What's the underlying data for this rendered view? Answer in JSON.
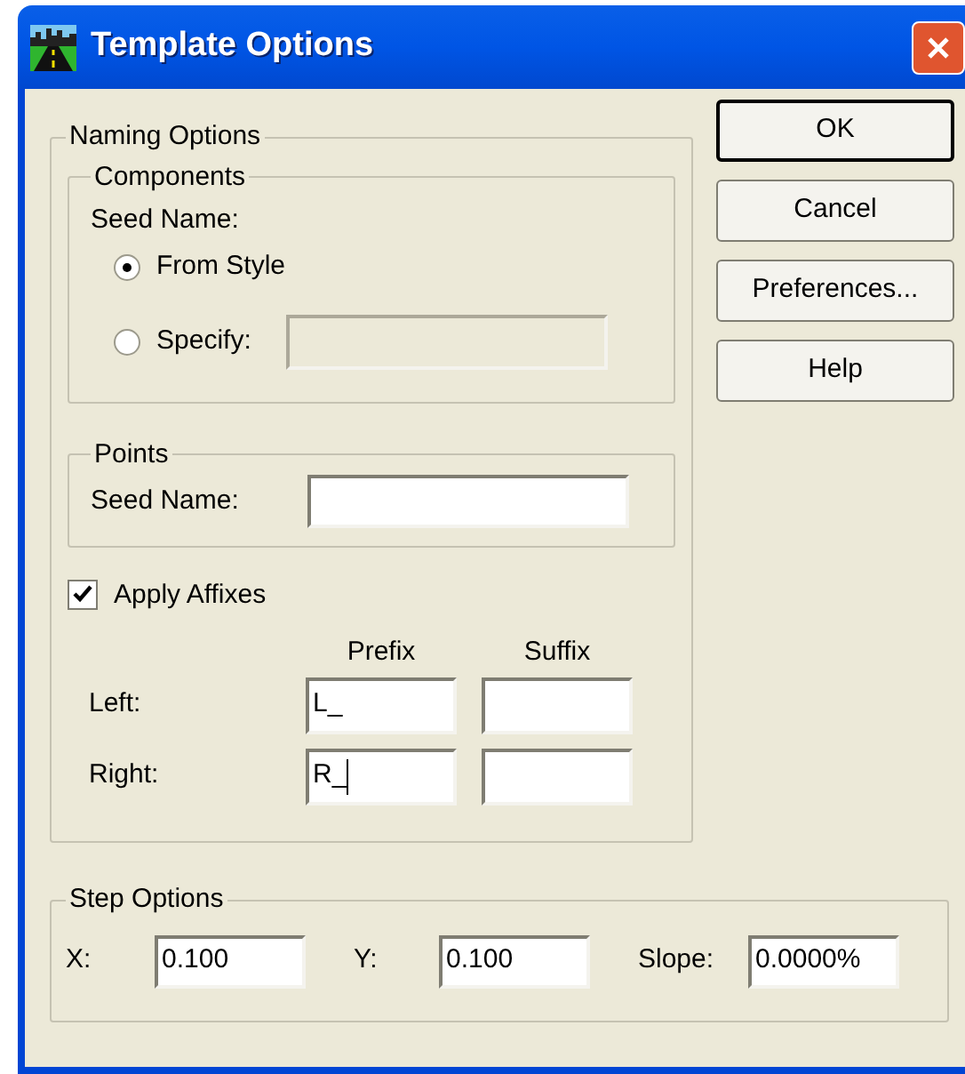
{
  "window": {
    "title": "Template Options"
  },
  "naming_options": {
    "title": "Naming Options",
    "components": {
      "title": "Components",
      "seed_name_label": "Seed Name:",
      "options": [
        {
          "label": "From Style",
          "selected": true
        },
        {
          "label": "Specify:",
          "selected": false
        }
      ],
      "specify_field_disabled": true
    },
    "points": {
      "title": "Points",
      "seed_name_label": "Seed Name:"
    },
    "apply_affixes": {
      "label": "Apply Affixes",
      "checked": true
    },
    "affix_columns": [
      "Prefix",
      "Suffix"
    ],
    "affix_rows": [
      {
        "label": "Left:",
        "prefix": "L_",
        "focused": false
      },
      {
        "label": "Right:",
        "prefix": "R_",
        "focused": true
      }
    ]
  },
  "buttons": [
    {
      "label": "OK",
      "default": true
    },
    {
      "label": "Cancel",
      "default": false
    },
    {
      "label": "Preferences...",
      "default": false
    },
    {
      "label": "Help",
      "default": false
    }
  ],
  "step_options": {
    "title": "Step Options",
    "fields": [
      {
        "label": "X:",
        "value": "0.100"
      },
      {
        "label": "Y:",
        "value": "0.100"
      },
      {
        "label": "Slope:",
        "value": "0.0000%"
      }
    ]
  }
}
